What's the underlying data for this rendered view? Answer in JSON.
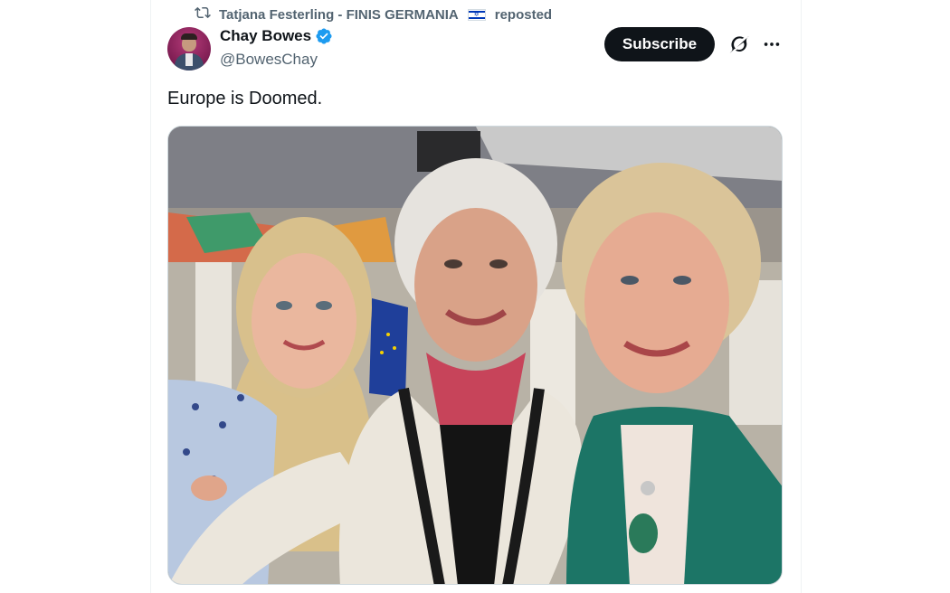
{
  "repost": {
    "user": "Tatjana Festerling - FINIS GERMANIA",
    "suffix": "reposted",
    "icon": "repost-icon",
    "flag": "israel-flag"
  },
  "author": {
    "name": "Chay Bowes",
    "handle": "@BowesChay",
    "verified": true
  },
  "actions": {
    "subscribe_label": "Subscribe",
    "grok_icon": "grok-icon",
    "more_icon": "more-icon"
  },
  "tweet": {
    "text": "Europe is Doomed."
  },
  "media": {
    "type": "photo",
    "description_icon": "photo-image"
  },
  "colors": {
    "text": "#0f1419",
    "secondary": "#536471",
    "verified_blue": "#1d9bf0",
    "button_dark": "#0f1419"
  }
}
